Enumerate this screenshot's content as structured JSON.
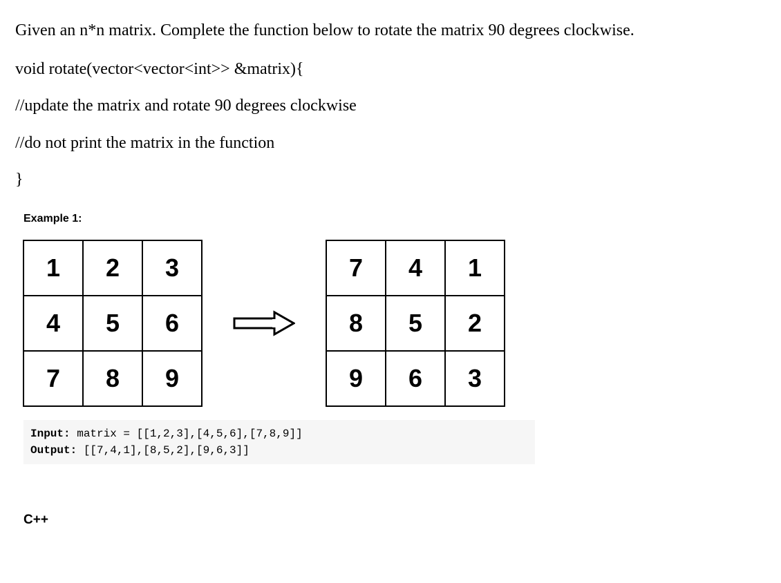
{
  "problem": {
    "description": "Given an n*n matrix. Complete the function below to rotate the matrix 90 degrees clockwise.",
    "signature": "void rotate(vector<vector<int>> &matrix){",
    "comment1": "//update the matrix and rotate 90 degrees clockwise",
    "comment2": "//do not print the matrix in the function",
    "closing_brace": "}"
  },
  "example": {
    "label": "Example 1:",
    "input_matrix": [
      [
        "1",
        "2",
        "3"
      ],
      [
        "4",
        "5",
        "6"
      ],
      [
        "7",
        "8",
        "9"
      ]
    ],
    "output_matrix": [
      [
        "7",
        "4",
        "1"
      ],
      [
        "8",
        "5",
        "2"
      ],
      [
        "9",
        "6",
        "3"
      ]
    ],
    "input_label": "Input:",
    "input_value": " matrix = [[1,2,3],[4,5,6],[7,8,9]]",
    "output_label": "Output:",
    "output_value": " [[7,4,1],[8,5,2],[9,6,3]]"
  },
  "language": "C++"
}
